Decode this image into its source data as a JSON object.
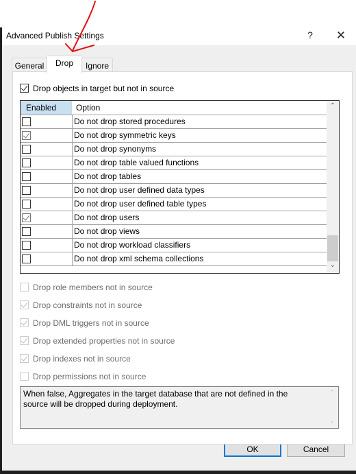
{
  "window": {
    "title": "Advanced Publish Settings",
    "help_label": "?",
    "close_label": "✕"
  },
  "tabs": [
    {
      "label": "General",
      "active": false
    },
    {
      "label": "Drop",
      "active": true
    },
    {
      "label": "Ignore",
      "active": false
    }
  ],
  "drop_objects": {
    "label": "Drop objects in target but not in source",
    "checked": true
  },
  "grid": {
    "columns": [
      "Enabled",
      "Option"
    ],
    "rows": [
      {
        "enabled": false,
        "option": "Do not drop stored procedures"
      },
      {
        "enabled": true,
        "option": "Do not drop symmetric keys"
      },
      {
        "enabled": false,
        "option": "Do not drop synonyms"
      },
      {
        "enabled": false,
        "option": "Do not drop table valued functions"
      },
      {
        "enabled": false,
        "option": "Do not drop tables"
      },
      {
        "enabled": false,
        "option": "Do not drop user defined data types"
      },
      {
        "enabled": false,
        "option": "Do not drop user defined table types"
      },
      {
        "enabled": true,
        "option": "Do not drop users"
      },
      {
        "enabled": false,
        "option": "Do not drop views"
      },
      {
        "enabled": false,
        "option": "Do not drop workload classifiers"
      },
      {
        "enabled": false,
        "option": "Do not drop xml schema collections"
      }
    ],
    "scroll_up_icon": "⌃",
    "scroll_down_icon": "⌄"
  },
  "disabled_options": [
    {
      "label": "Drop role members not in source",
      "checked": false
    },
    {
      "label": "Drop constraints not in source",
      "checked": true
    },
    {
      "label": "Drop DML triggers not in source",
      "checked": true
    },
    {
      "label": "Drop extended properties not in source",
      "checked": true
    },
    {
      "label": "Drop indexes not in source",
      "checked": true
    },
    {
      "label": "Drop permissions not in source",
      "checked": false
    }
  ],
  "description": {
    "text": "When false, Aggregates in the target database that are not defined in the source will be dropped during deployment."
  },
  "buttons": {
    "ok": "OK",
    "cancel": "Cancel"
  },
  "annotations": {
    "color": "#e01010"
  }
}
